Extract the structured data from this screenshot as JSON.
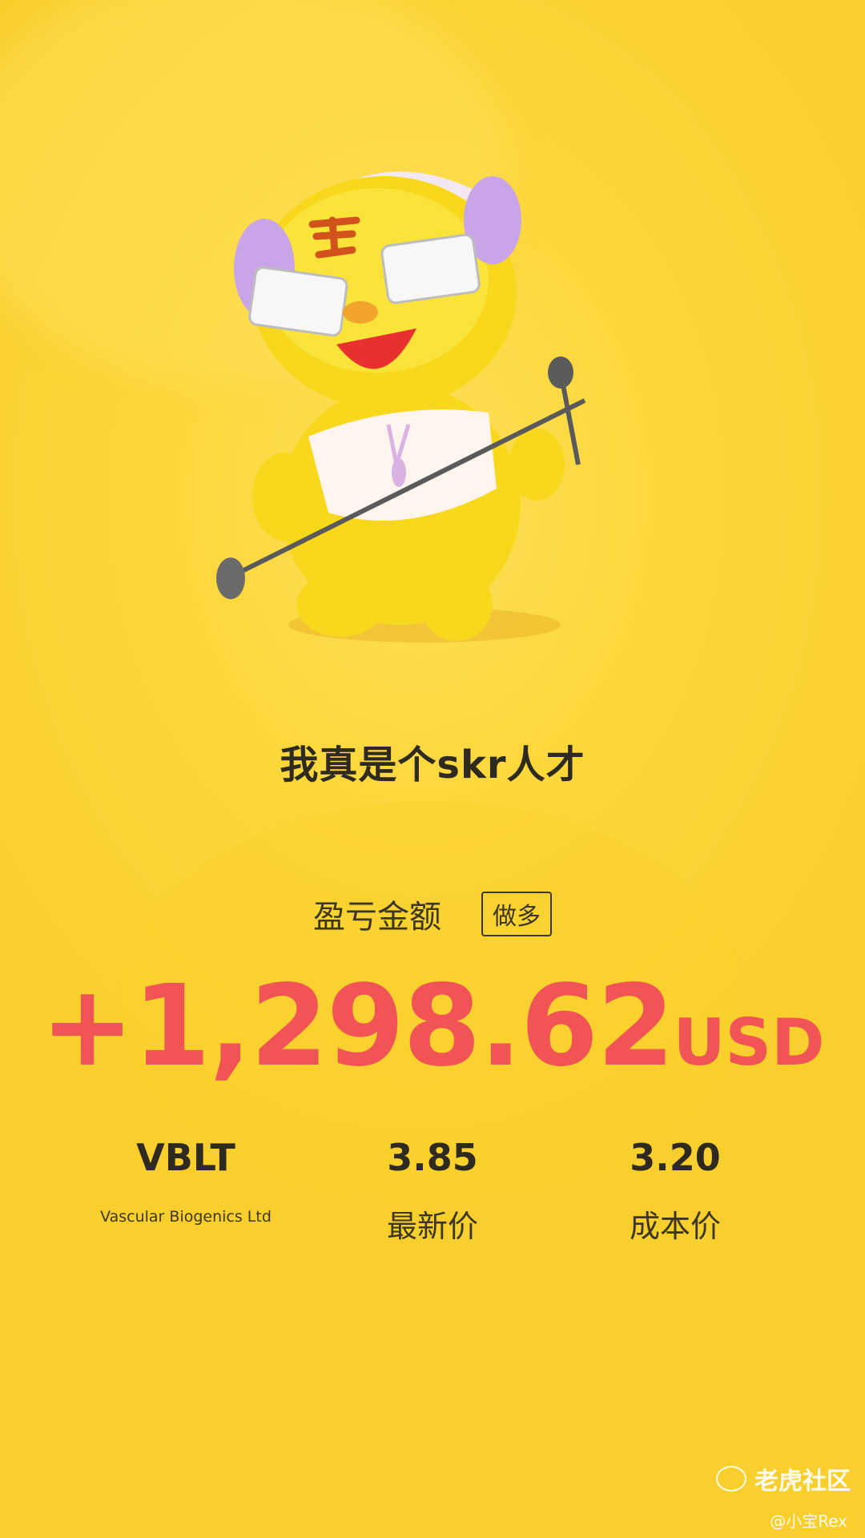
{
  "header": {
    "title": "我真是个skr人才"
  },
  "profit": {
    "label": "盈亏金额",
    "direction": "做多",
    "amount": "+1,298.62",
    "currency": "USD",
    "color": "#f05454"
  },
  "stats": {
    "symbol": "VBLT",
    "company": "Vascular Biogenics Ltd",
    "latest_price": "3.85",
    "latest_price_label": "最新价",
    "cost_price": "3.20",
    "cost_price_label": "成本价"
  },
  "watermark": {
    "brand": "老虎社区",
    "author": "@小宝Rex"
  },
  "colors": {
    "background": "#fcd73a",
    "accent": "#f05454",
    "text": "#2f2a1f"
  },
  "icons": {
    "mascot": "tiger-mascot-with-headphones-and-microphone",
    "brand_logo": "tiger-logo-icon"
  }
}
